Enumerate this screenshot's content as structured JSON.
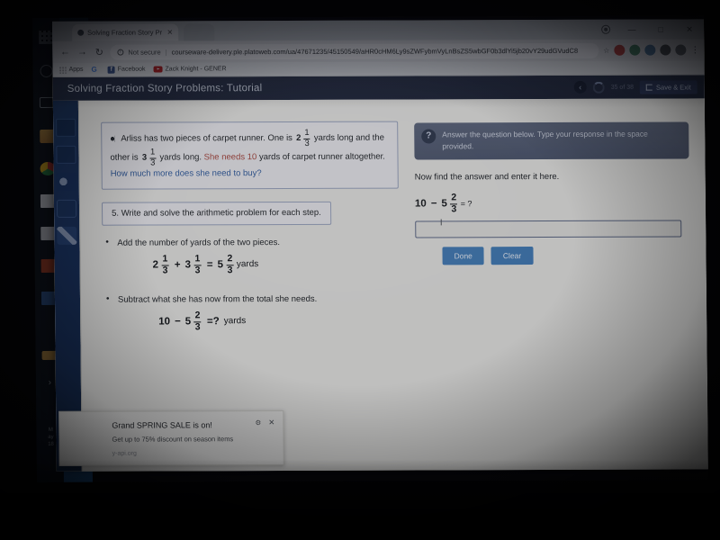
{
  "browser": {
    "tab": {
      "title": "Solving Fraction Story Pr",
      "close_label": "✕"
    },
    "new_tab_label": "",
    "window_controls": {
      "minimize": "—",
      "maximize": "□",
      "close": "✕"
    },
    "nav": {
      "back": "←",
      "forward": "→",
      "reload": "↻"
    },
    "omnibox": {
      "security_icon": "info-icon",
      "security_label": "Not secure",
      "separator": "|",
      "url": "courseware-delivery.ple.platoweb.com/ua/47671235/45150549/aHR0cHM6Ly9sZWFybmVyLnBsZS5wbGF0b3dlYi5jb20vY29udGVudC8",
      "star": "☆"
    },
    "bookmarks": [
      {
        "name": "apps-bookmark",
        "label": "Apps",
        "icon": "grid-icon"
      },
      {
        "name": "google-bookmark",
        "label": "",
        "icon": "google-g-icon"
      },
      {
        "name": "facebook-bookmark",
        "label": "Facebook",
        "icon": "facebook-icon"
      },
      {
        "name": "youtube-bookmark",
        "label": "Zack Knight - GENER",
        "icon": "youtube-icon"
      }
    ],
    "extension_menu": "⋮"
  },
  "taskbar": {
    "clock_time": "M",
    "clock_day": "ay",
    "clock_date": "18"
  },
  "lesson": {
    "title": "Solving Fraction Story Problems: Tutorial",
    "back_icon": "‹",
    "page_count": "35 of 38",
    "save_exit_label": "Save & Exit"
  },
  "tools": [
    {
      "name": "tool-notes",
      "icon": "notes-icon"
    },
    {
      "name": "tool-dictionary",
      "icon": "dictionary-icon"
    },
    {
      "name": "tool-audio",
      "icon": "speaker-icon"
    },
    {
      "name": "tool-note-flag",
      "icon": "note-bubble-icon"
    },
    {
      "name": "tool-highlighter",
      "icon": "highlighter-icon"
    }
  ],
  "problem": {
    "speaker_icon": "speaker-icon",
    "line1_a": "Arliss has two pieces of carpet runner. One is",
    "frac1": {
      "whole": "2",
      "num": "1",
      "den": "3"
    },
    "line1_b": "yards long and the",
    "line2_a": "other is",
    "frac2": {
      "whole": "3",
      "num": "1",
      "den": "3"
    },
    "line2_b": "yards long.",
    "line2_red": "She needs 10",
    "line2_c": "yards of carpet runner altogether.",
    "line3_blue": "How much more does she need to buy?"
  },
  "question5": {
    "number": "5.",
    "text": "Write and solve the arithmetic problem for each step."
  },
  "steps": [
    {
      "text": "Add the number of yards of the two pieces.",
      "equation": {
        "term1": {
          "whole": "2",
          "num": "1",
          "den": "3"
        },
        "op1": "+",
        "term2": {
          "whole": "3",
          "num": "1",
          "den": "3"
        },
        "op2": "=",
        "term3": {
          "whole": "5",
          "num": "2",
          "den": "3"
        },
        "unit": "yards"
      }
    },
    {
      "text": "Subtract what she has now from the total she needs.",
      "equation": {
        "term1": {
          "whole": "10",
          "num": "",
          "den": ""
        },
        "op1": "−",
        "term2": {
          "whole": "5",
          "num": "2",
          "den": "3"
        },
        "op2": "=?",
        "unit": "yards"
      }
    }
  ],
  "answer_panel": {
    "hint_icon": "?",
    "hint_text": "Answer the question below. Type your response in the space provided.",
    "prompt": "Now find the answer and enter it here.",
    "equation": {
      "left": "10",
      "op": "−",
      "whole": "5",
      "num": "2",
      "den": "3",
      "tail": "= ?"
    },
    "input_value": "",
    "input_placeholder": "",
    "caret": "I",
    "done_label": "Done",
    "clear_label": "Clear"
  },
  "toast": {
    "title": "Grand SPRING SALE is on!",
    "subtitle": "Get up to 75% discount on season items",
    "source": "y-api.org",
    "gear_icon": "⚙",
    "close_icon": "✕"
  },
  "colors": {
    "accent_blue": "#3f7fbf",
    "header_navy": "#2b3550",
    "sidebar_navy": "#19315c",
    "highlight_red": "#b2473f",
    "highlight_blue": "#2f5fa8"
  }
}
